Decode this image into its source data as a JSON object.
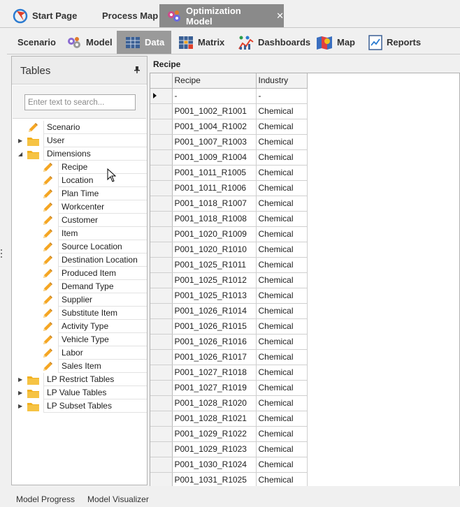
{
  "doc_tabs": [
    {
      "label": "Start Page",
      "icon": "start-page-icon"
    },
    {
      "label": "Process Map",
      "icon": ""
    },
    {
      "label": "Optimization Model",
      "icon": "model-gears-icon",
      "active": true,
      "close": "✕"
    }
  ],
  "ribbon": [
    {
      "label": "Scenario",
      "icon": ""
    },
    {
      "label": "Model",
      "icon": "gears-icon"
    },
    {
      "label": "Data",
      "icon": "table-icon",
      "active": true
    },
    {
      "label": "Matrix",
      "icon": "matrix-icon"
    },
    {
      "label": "Dashboards",
      "icon": "dashboard-chart-icon"
    },
    {
      "label": "Map",
      "icon": "map-icon"
    },
    {
      "label": "Reports",
      "icon": "report-icon"
    }
  ],
  "panel": {
    "title": "Tables",
    "search_placeholder": "Enter text to search..."
  },
  "tree": [
    {
      "label": "Scenario",
      "type": "table"
    },
    {
      "label": "User",
      "type": "folder",
      "expander": "collapsed"
    },
    {
      "label": "Dimensions",
      "type": "folder",
      "expander": "expanded"
    },
    {
      "label": "Recipe",
      "type": "table",
      "child": true
    },
    {
      "label": "Location",
      "type": "table",
      "child": true
    },
    {
      "label": "Plan Time",
      "type": "table",
      "child": true
    },
    {
      "label": "Workcenter",
      "type": "table",
      "child": true
    },
    {
      "label": "Customer",
      "type": "table",
      "child": true
    },
    {
      "label": "Item",
      "type": "table",
      "child": true
    },
    {
      "label": "Source Location",
      "type": "table",
      "child": true
    },
    {
      "label": "Destination Location",
      "type": "table",
      "child": true
    },
    {
      "label": "Produced Item",
      "type": "table",
      "child": true
    },
    {
      "label": "Demand Type",
      "type": "table",
      "child": true
    },
    {
      "label": "Supplier",
      "type": "table",
      "child": true
    },
    {
      "label": "Substitute Item",
      "type": "table",
      "child": true
    },
    {
      "label": "Activity Type",
      "type": "table",
      "child": true
    },
    {
      "label": "Vehicle Type",
      "type": "table",
      "child": true
    },
    {
      "label": "Labor",
      "type": "table",
      "child": true
    },
    {
      "label": "Sales Item",
      "type": "table",
      "child": true
    },
    {
      "label": "LP Restrict Tables",
      "type": "folder",
      "expander": "collapsed"
    },
    {
      "label": "LP Value Tables",
      "type": "folder",
      "expander": "collapsed"
    },
    {
      "label": "LP Subset Tables",
      "type": "folder",
      "expander": "collapsed"
    }
  ],
  "grid": {
    "title": "Recipe",
    "columns": [
      "Recipe",
      "Industry"
    ],
    "rows": [
      [
        "-",
        "-"
      ],
      [
        "P001_1002_R1001",
        "Chemical"
      ],
      [
        "P001_1004_R1002",
        "Chemical"
      ],
      [
        "P001_1007_R1003",
        "Chemical"
      ],
      [
        "P001_1009_R1004",
        "Chemical"
      ],
      [
        "P001_1011_R1005",
        "Chemical"
      ],
      [
        "P001_1011_R1006",
        "Chemical"
      ],
      [
        "P001_1018_R1007",
        "Chemical"
      ],
      [
        "P001_1018_R1008",
        "Chemical"
      ],
      [
        "P001_1020_R1009",
        "Chemical"
      ],
      [
        "P001_1020_R1010",
        "Chemical"
      ],
      [
        "P001_1025_R1011",
        "Chemical"
      ],
      [
        "P001_1025_R1012",
        "Chemical"
      ],
      [
        "P001_1025_R1013",
        "Chemical"
      ],
      [
        "P001_1026_R1014",
        "Chemical"
      ],
      [
        "P001_1026_R1015",
        "Chemical"
      ],
      [
        "P001_1026_R1016",
        "Chemical"
      ],
      [
        "P001_1026_R1017",
        "Chemical"
      ],
      [
        "P001_1027_R1018",
        "Chemical"
      ],
      [
        "P001_1027_R1019",
        "Chemical"
      ],
      [
        "P001_1028_R1020",
        "Chemical"
      ],
      [
        "P001_1028_R1021",
        "Chemical"
      ],
      [
        "P001_1029_R1022",
        "Chemical"
      ],
      [
        "P001_1029_R1023",
        "Chemical"
      ],
      [
        "P001_1030_R1024",
        "Chemical"
      ],
      [
        "P001_1031_R1025",
        "Chemical"
      ]
    ]
  },
  "bottom_tabs": [
    {
      "label": "Model Progress"
    },
    {
      "label": "Model Visualizer"
    }
  ],
  "colors": {
    "active_tab_bg": "#8a8a8a",
    "active_ribbon_bg": "#9a9a9a",
    "pencil": "#f5a623",
    "folder": "#f2b01e"
  }
}
